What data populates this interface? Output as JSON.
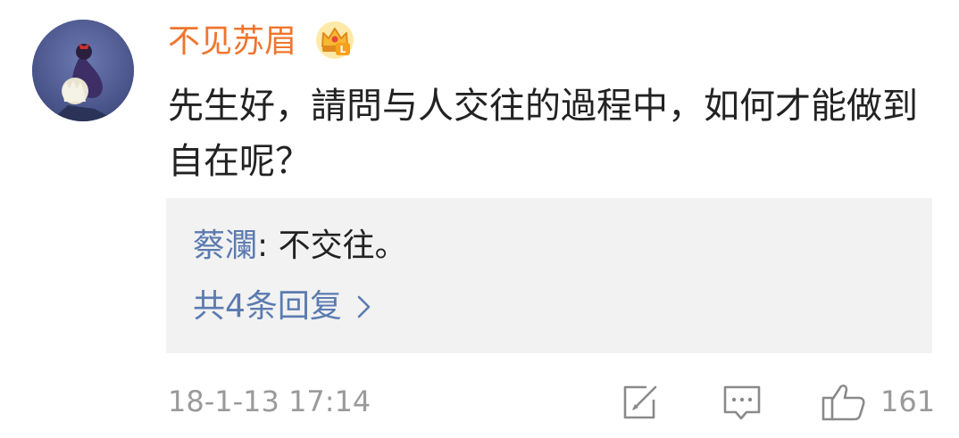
{
  "comment": {
    "username": "不见苏眉",
    "badge_icon": "crown-badge-icon",
    "text": "先生好，請問与人交往的過程中，如何才能做到自在呢？",
    "timestamp": "18-1-13 17:14",
    "like_count": "161"
  },
  "reply": {
    "author": "蔡瀾",
    "separator": ":",
    "text": " 不交往。",
    "more_label": "共4条回复"
  },
  "colors": {
    "username": "#f0752e",
    "link": "#5b7bb0",
    "text": "#222222",
    "meta": "#9a9a9a",
    "reply_bg": "#f2f2f2"
  },
  "icons": {
    "repost": "repost-icon",
    "comment": "comment-icon",
    "like": "thumbs-up-icon",
    "more": "chevron-right-icon"
  }
}
